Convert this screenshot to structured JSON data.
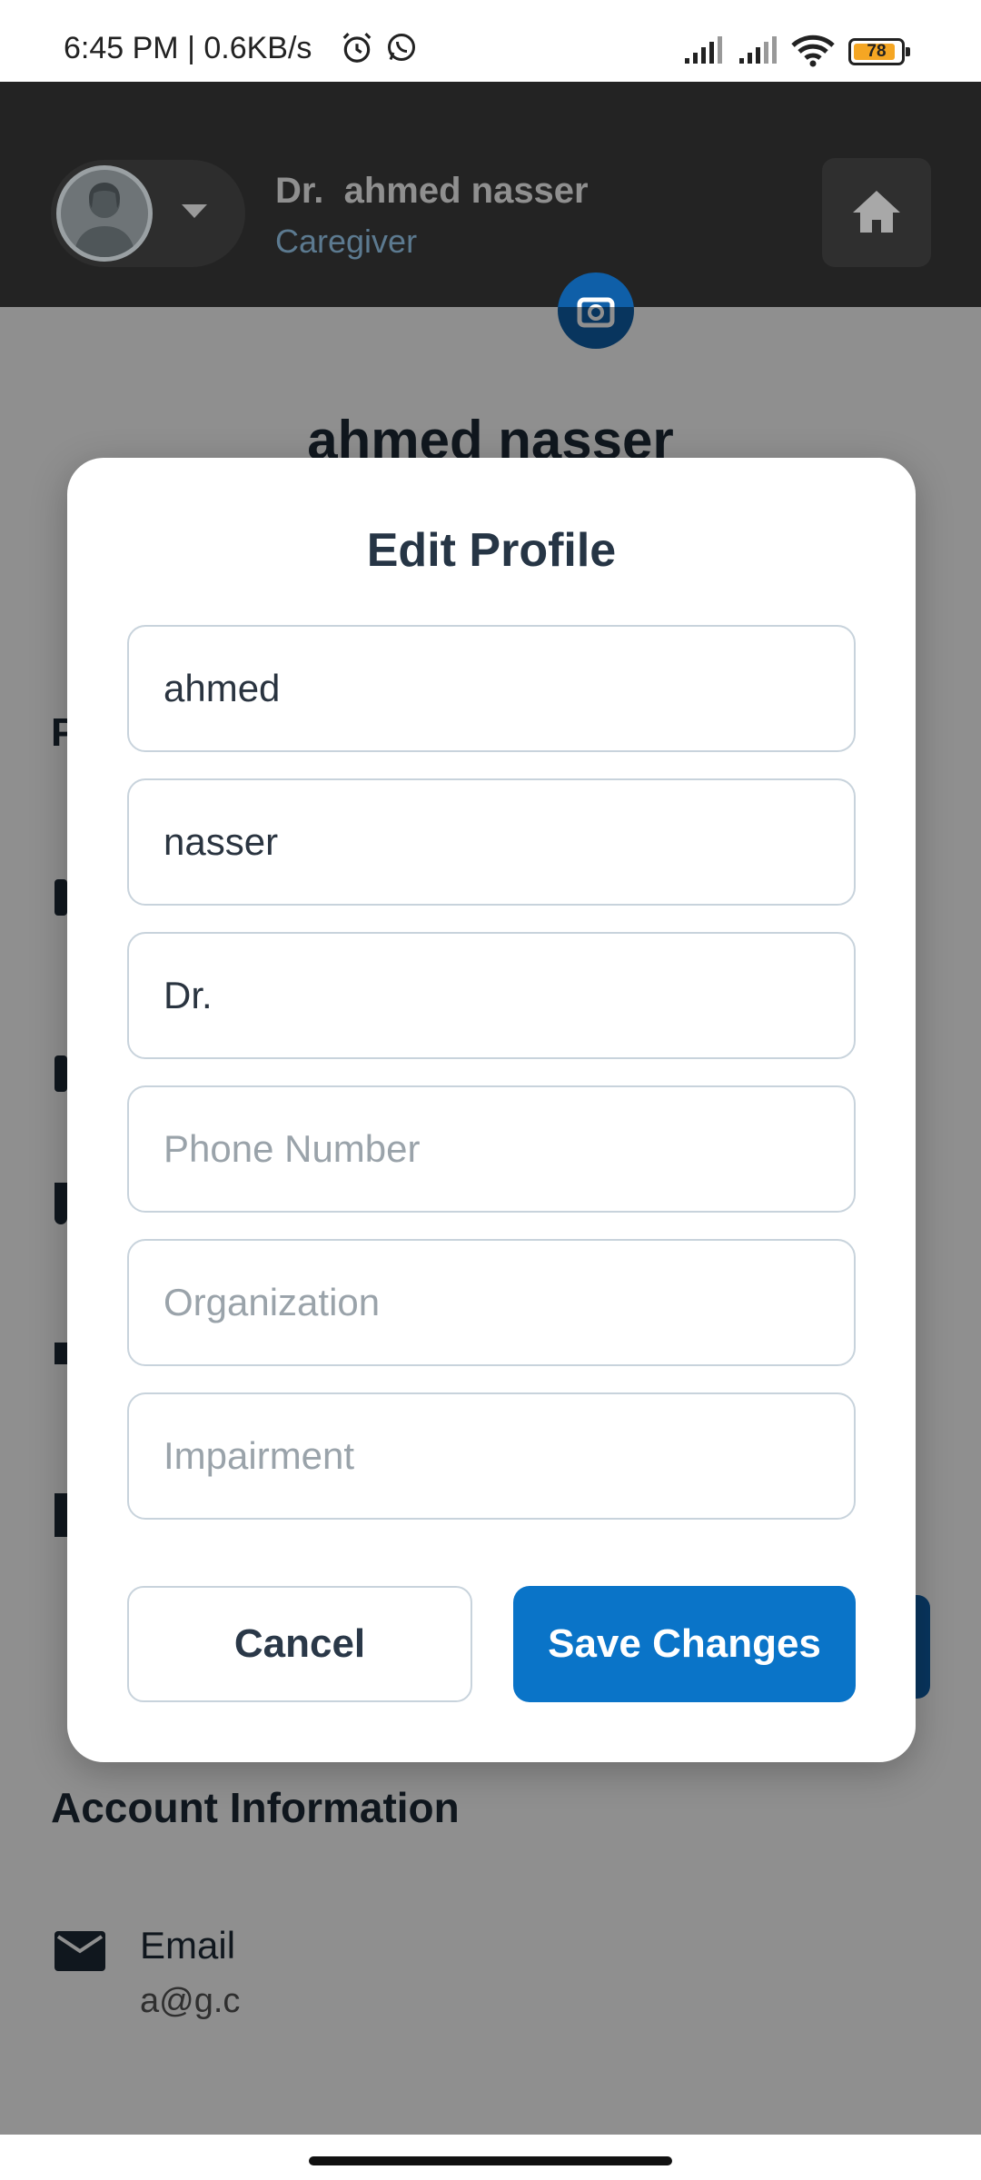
{
  "status_bar": {
    "left_text": "6:45 PM | 0.6KB/s",
    "battery": "78",
    "icons": [
      "alarm-icon",
      "whatsapp-icon",
      "signal-icon",
      "signal-icon",
      "wifi-icon",
      "battery-icon"
    ]
  },
  "app_bar": {
    "prefix": "Dr.",
    "name": "ahmed nasser",
    "role": "Caregiver",
    "home_icon": "home-icon",
    "dropdown_icon": "chevron-down-icon"
  },
  "background": {
    "profile_name": "ahmed nasser",
    "fragment_p": "P",
    "section_title": "Account Information",
    "email_label": "Email",
    "email_value": "a@g.c"
  },
  "dialog": {
    "title": "Edit Profile",
    "fields": [
      {
        "value": "ahmed",
        "placeholder": ""
      },
      {
        "value": "nasser",
        "placeholder": ""
      },
      {
        "value": "Dr.",
        "placeholder": ""
      },
      {
        "value": "",
        "placeholder": "Phone Number"
      },
      {
        "value": "",
        "placeholder": "Organization"
      },
      {
        "value": "",
        "placeholder": "Impairment"
      }
    ],
    "cancel_label": "Cancel",
    "save_label": "Save Changes"
  },
  "colors": {
    "primary": "#0a74c8",
    "app_bar": "#232323",
    "role": "#5c7a90",
    "title": "#263545"
  }
}
